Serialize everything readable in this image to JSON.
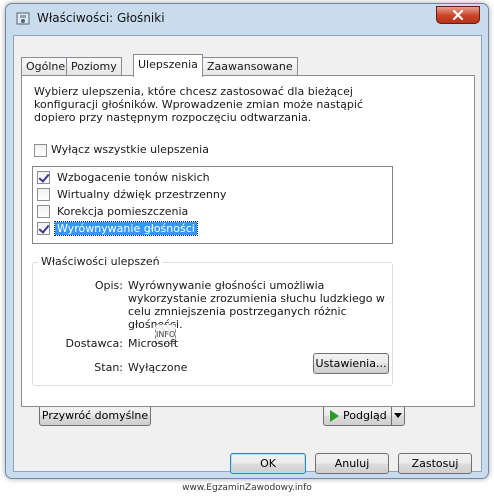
{
  "window": {
    "title": "Właściwości: Głośniki"
  },
  "tabs": [
    {
      "label": "Ogólne"
    },
    {
      "label": "Poziomy"
    },
    {
      "label": "Ulepszenia"
    },
    {
      "label": "Zaawansowane"
    }
  ],
  "enhancements": {
    "description": "Wybierz ulepszenia, które chcesz zastosować dla bieżącej konfiguracji głośników. Wprowadzenie zmian może nastąpić dopiero przy następnym rozpoczęciu odtwarzania.",
    "disable_all_label": "Wyłącz wszystkie ulepszenia",
    "disable_all_checked": false,
    "items": [
      {
        "label": "Wzbogacenie tonów niskich",
        "checked": true
      },
      {
        "label": "Wirtualny dźwięk przestrzenny",
        "checked": false
      },
      {
        "label": "Korekcja pomieszczenia",
        "checked": false
      },
      {
        "label": "Wyrównywanie głośności",
        "checked": true,
        "selected": true
      }
    ]
  },
  "properties": {
    "group_title": "Właściwości ulepszeń",
    "description_label": "Opis:",
    "description_value": "Wyrównywanie głośności umożliwia wykorzystanie zrozumienia słuchu ludzkiego w celu zmniejszenia postrzeganych różnic głośności.",
    "provider_label": "Dostawca:",
    "provider_value": "Microsoft",
    "status_label": "Stan:",
    "status_value": "Wyłączone",
    "settings_button": "Ustawienia...",
    "info_icon_text": "INFO"
  },
  "buttons": {
    "restore_defaults": "Przywróć domyślne",
    "preview": "Podgląd",
    "ok": "OK",
    "cancel": "Anuluj",
    "apply": "Zastosuj"
  },
  "footer": {
    "watermark": "www.EgzaminZawodowy.info"
  },
  "colors": {
    "selection": "#3399ff",
    "close_button": "#c8432a",
    "play_icon": "#2b9a2b"
  }
}
